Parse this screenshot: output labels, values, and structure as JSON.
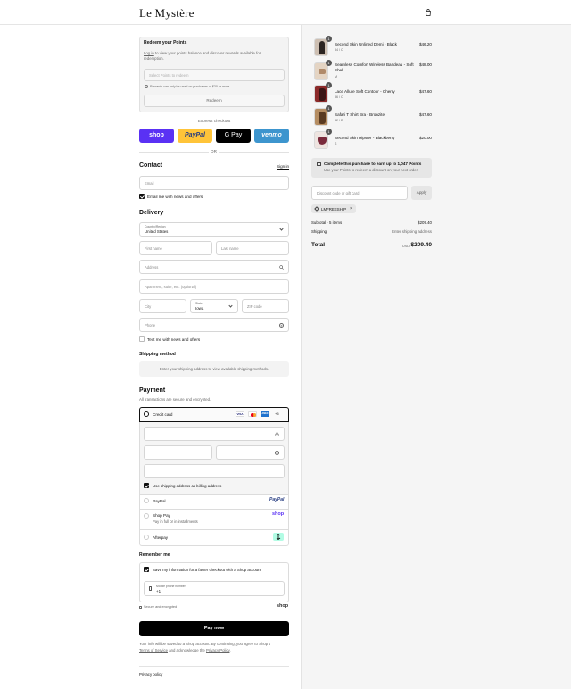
{
  "brand": {
    "logo": "Le Mystère"
  },
  "redeem": {
    "title": "Redeem your Points",
    "desc_link": "Log in",
    "desc_rest": " to view your points balance and discover rewards available for redemption.",
    "select_placeholder": "Select Points to redeem",
    "note": "Rewards can only be used on purchases of $30 or more.",
    "button": "Redeem"
  },
  "express": {
    "title": "Express checkout",
    "shop": "shop",
    "paypal": "PayPal",
    "gpay": "G Pay",
    "venmo": "venmo",
    "or": "OR"
  },
  "contact": {
    "title": "Contact",
    "signin": "Sign in",
    "email_placeholder": "Email",
    "email_offers": "Email me with news and offers"
  },
  "delivery": {
    "title": "Delivery",
    "country_label": "Country/Region",
    "country_value": "United States",
    "first_name": "First name",
    "last_name": "Last name",
    "address": "Address",
    "apartment": "Apartment, suite, etc. (optional)",
    "city": "City",
    "state_label": "State",
    "state_value": "Iowa",
    "zip": "ZIP code",
    "phone": "Phone",
    "text_offers": "Text me with news and offers"
  },
  "shipping": {
    "title": "Shipping method",
    "message": "Enter your shipping address to view available shipping methods."
  },
  "payment": {
    "title": "Payment",
    "subtitle": "All transactions are secure and encrypted.",
    "credit_card": "Credit card",
    "card_more": "+5",
    "billing_same": "Use shipping address as billing address",
    "paypal": "PayPal",
    "paypal_logo": "PayPal",
    "shoppay": "Shop Pay",
    "shoppay_sub": "Pay in full or in installments",
    "shoppay_logo": "shop",
    "afterpay": "Afterpay"
  },
  "remember": {
    "title": "Remember me",
    "save_info": "Save my information for a faster checkout with a Shop account",
    "mobile_label": "Mobile phone number",
    "mobile_value": "+1",
    "secure": "Secure and encrypted",
    "shop_logo": "shop"
  },
  "pay_now": "Pay now",
  "legal": {
    "line1": "Your info will be saved to a Shop account. By continuing, you agree to Shop's",
    "terms": "Terms of Service",
    "mid": " and acknowledge the ",
    "privacy": "Privacy Policy",
    "end": "."
  },
  "footer": {
    "privacy_policy": "Privacy policy"
  },
  "items": [
    {
      "name": "Second Skin Unlined Demi - Black",
      "variant": "34 / C",
      "price": "$46.20",
      "qty": "1"
    },
    {
      "name": "Seamless Comfort Wireless Bandeau - Soft Shell",
      "variant": "M",
      "price": "$48.00",
      "qty": "1"
    },
    {
      "name": "Lace Allure Soft Contour - Cherry",
      "variant": "36 / C",
      "price": "$47.60",
      "qty": "1"
    },
    {
      "name": "Safari T Shirt Bra - Bronzite",
      "variant": "32 / D",
      "price": "$47.60",
      "qty": "1"
    },
    {
      "name": "Second Skin Hipster - Blackberry",
      "variant": "S",
      "price": "$20.00",
      "qty": "1"
    }
  ],
  "points_banner": {
    "title": "Complete this purchase to earn up to 1,047 Points",
    "sub": "Use your Points to redeem a discount on your next order."
  },
  "discount": {
    "placeholder": "Discount code or gift card",
    "apply": "Apply",
    "code": "LMFREESHIP"
  },
  "summary": {
    "subtotal_label": "Subtotal · 5 items",
    "subtotal": "$209.40",
    "shipping_label": "Shipping",
    "shipping_value": "Enter shipping address",
    "total_label": "Total",
    "currency": "USD",
    "total": "$209.40"
  },
  "colors": {
    "shop": "#5a31f4",
    "paypal": "#ffc439",
    "venmo": "#3d95ce",
    "afterpay": "#b2fce4"
  }
}
